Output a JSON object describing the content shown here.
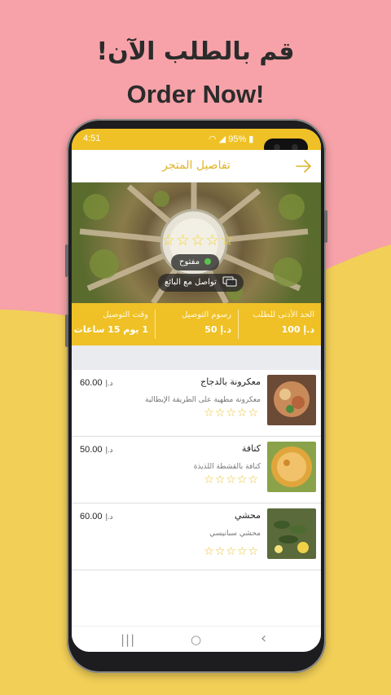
{
  "promo": {
    "headline_ar": "قم بالطلب الآن!",
    "headline_en": "Order Now!",
    "colors": {
      "pink": "#f6a2a8",
      "yellow": "#f2cf57",
      "accent": "#efc126"
    }
  },
  "status_bar": {
    "time": "4:51",
    "battery": "95%"
  },
  "app_bar": {
    "title": "تفاصيل المتجر",
    "back_icon": "arrow-right-icon"
  },
  "store": {
    "rating_stars": "☆☆☆☆☆",
    "status": "مفتوح",
    "contact_label": "تواصل مع البائع"
  },
  "info": {
    "min_order_label": "الحد الأدنى للطلب",
    "min_order_value": "100",
    "delivery_fee_label": "رسوم التوصيل",
    "delivery_fee_value": "50",
    "delivery_time_label": "وقت التوصيل",
    "delivery_time_value": "1 يوم 15 ساعات",
    "currency": "د.إ"
  },
  "items": [
    {
      "name": "معكرونة بالدجاج",
      "desc": "معكرونة مطهية على الطريقة الإيطالية",
      "price": "60.00",
      "currency": "د.إ",
      "stars": "☆☆☆☆☆"
    },
    {
      "name": "كنافة",
      "desc": "كنافة بالقشطة اللذيذة",
      "price": "50.00",
      "currency": "د.إ",
      "stars": "☆☆☆☆☆"
    },
    {
      "name": "محشي",
      "desc": "محشي سبانيسي",
      "price": "60.00",
      "currency": "د.إ",
      "stars": "☆☆☆☆☆"
    }
  ],
  "nav": {
    "recent": "|||",
    "home": "○",
    "back": "‹"
  }
}
